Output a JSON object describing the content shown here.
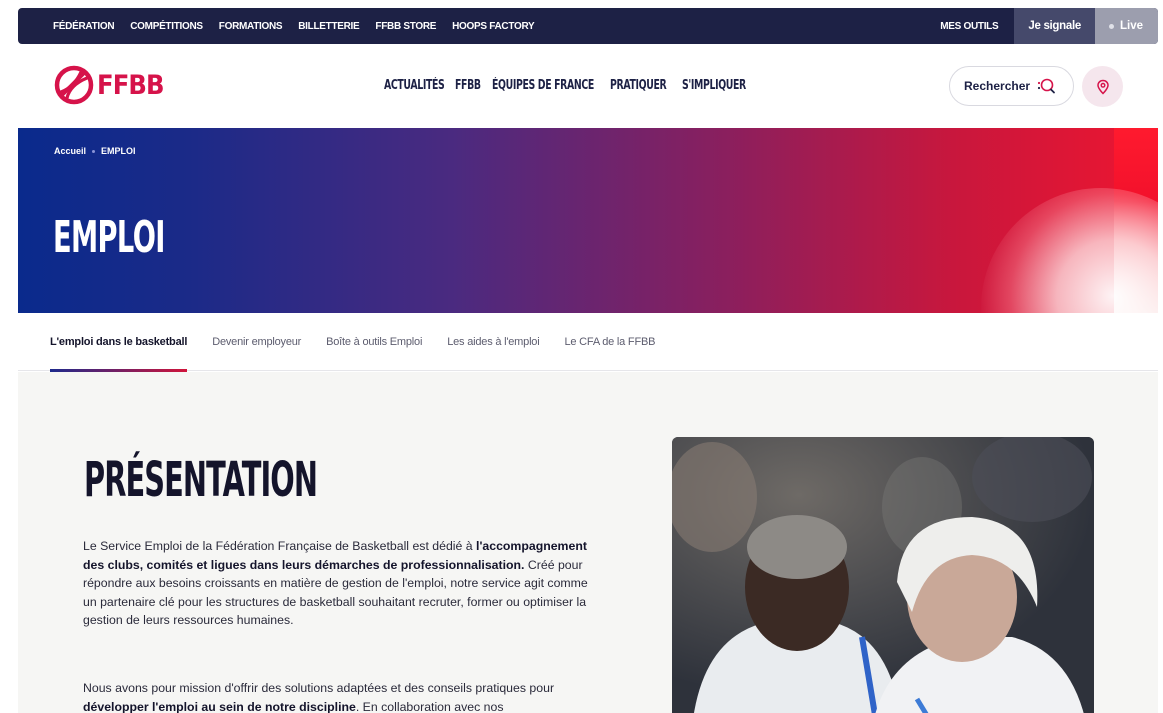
{
  "topbar": {
    "links": [
      "FÉDÉRATION",
      "COMPÉTITIONS",
      "FORMATIONS",
      "BILLETTERIE",
      "FFBB STORE",
      "HOOPS FACTORY"
    ],
    "mes_outils": "MES OUTILS",
    "je_signale": "Je signale",
    "live": "Live"
  },
  "header": {
    "logo_text": "FFBB",
    "nav": [
      "ACTUALITÉS",
      "FFBB",
      "ÉQUIPES DE FRANCE",
      "PRATIQUER",
      "S'IMPLIQUER"
    ],
    "search_label": "Rechercher",
    "icons": {
      "search": "search-icon",
      "location": "location-pin-icon"
    }
  },
  "hero": {
    "breadcrumb": [
      "Accueil",
      "EMPLOI"
    ],
    "title": "EMPLOI"
  },
  "subtabs": [
    "L'emploi dans le basketball",
    "Devenir employeur",
    "Boîte à outils Emploi",
    "Les aides à l'emploi",
    "Le CFA de la FFBB"
  ],
  "content": {
    "title": "PRÉSENTATION",
    "p1": {
      "a": "Le Service Emploi de la Fédération Française de Basketball est dédié à ",
      "b": "l'accompagnement des clubs, comités et ligues dans leurs démarches de professionnalisation.",
      "c": " Créé pour répondre aux besoins croissants en matière de gestion de l'emploi, notre service agit comme un partenaire clé pour les structures de basketball souhaitant recruter, former ou optimiser la gestion de leurs ressources humaines."
    },
    "p2": {
      "a": "Nous avons pour mission d'offrir des solutions adaptées et des conseils pratiques pour ",
      "b": "développer l'emploi au sein de notre discipline",
      "c": ". En collaboration avec nos"
    }
  },
  "colors": {
    "navy": "#1d2145",
    "brand_red": "#d6134a",
    "hero_blue": "#0a2a8c",
    "hero_red": "#ee1530"
  }
}
